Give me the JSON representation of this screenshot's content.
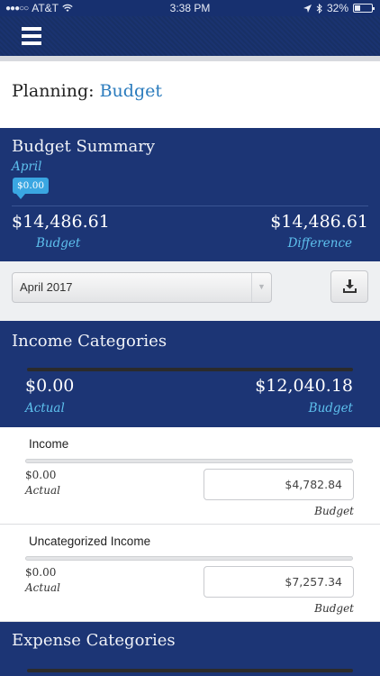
{
  "status_bar": {
    "carrier": "AT&T",
    "time": "3:38 PM",
    "battery": "32%",
    "battery_level": 0.32
  },
  "page": {
    "title_prefix": "Planning:",
    "title_accent": "Budget"
  },
  "summary": {
    "heading": "Budget Summary",
    "month": "April",
    "badge": "$0.00",
    "budget_amount": "$14,486.61",
    "budget_label": "Budget",
    "difference_amount": "$14,486.61",
    "difference_label": "Difference"
  },
  "toolbar": {
    "selected_month": "April 2017"
  },
  "income": {
    "heading": "Income Categories",
    "actual_amount": "$0.00",
    "actual_label": "Actual",
    "budget_amount": "$12,040.18",
    "budget_label": "Budget",
    "categories": [
      {
        "name": "Income",
        "actual": "$0.00",
        "actual_label": "Actual",
        "budget": "$4,782.84",
        "budget_label": "Budget"
      },
      {
        "name": "Uncategorized Income",
        "actual": "$0.00",
        "actual_label": "Actual",
        "budget": "$7,257.34",
        "budget_label": "Budget"
      }
    ]
  },
  "expense": {
    "heading": "Expense Categories"
  },
  "colors": {
    "navy": "#1c3575",
    "accent_blue": "#5ec1ee",
    "link_blue": "#2a7bbd"
  }
}
